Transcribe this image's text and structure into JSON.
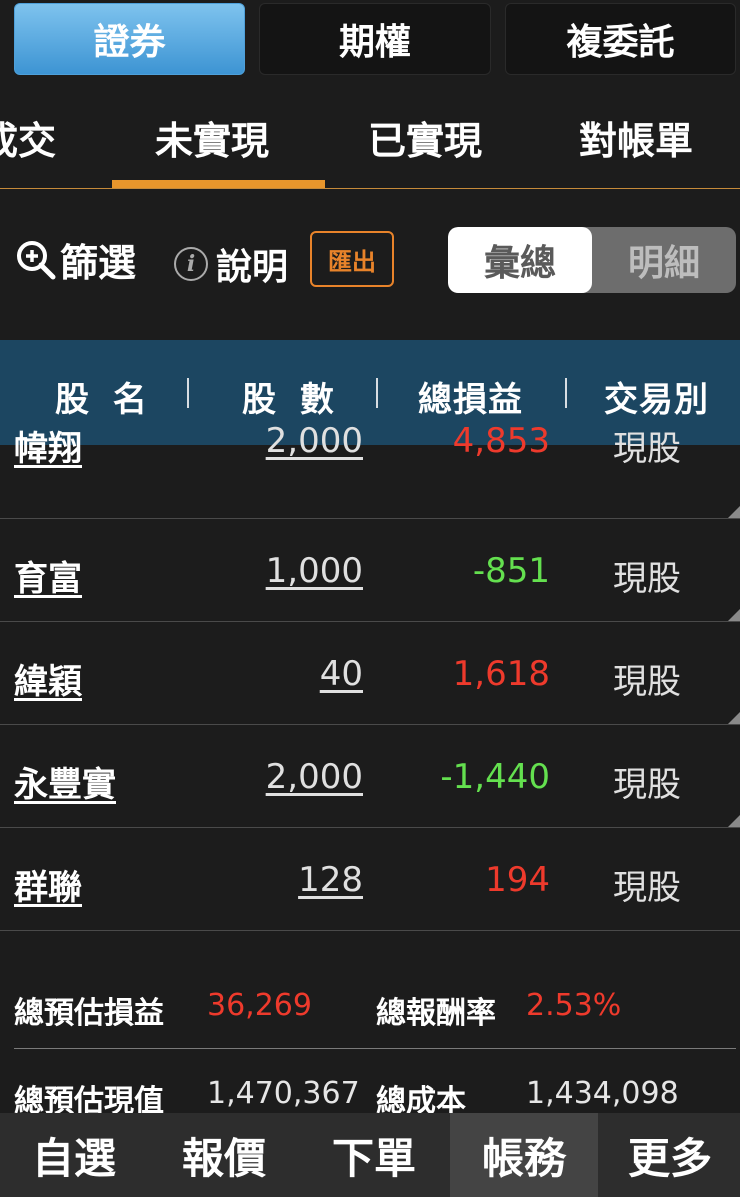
{
  "top_tabs": [
    {
      "label": "證券",
      "active": true
    },
    {
      "label": "期權",
      "active": false
    },
    {
      "label": "複委託",
      "active": false
    }
  ],
  "sub_tabs": [
    {
      "label": "成交"
    },
    {
      "label": "未實現",
      "active": true
    },
    {
      "label": "已實現"
    },
    {
      "label": "對帳單"
    }
  ],
  "toolbar": {
    "filter_label": "篩選",
    "explain_label": "說明",
    "info_glyph": "i",
    "export_label": "匯出",
    "toggle": {
      "on": "彙總",
      "off": "明細"
    }
  },
  "table": {
    "headers": [
      "股 名",
      "股 數",
      "總損益",
      "交易別"
    ],
    "rows": [
      {
        "name": "幃翔",
        "qty": "2,000",
        "pl": "4,853",
        "pl_sign": "pos",
        "type": "現股"
      },
      {
        "name": "育富",
        "qty": "1,000",
        "pl": "-851",
        "pl_sign": "neg",
        "type": "現股"
      },
      {
        "name": "緯穎",
        "qty": "40",
        "pl": "1,618",
        "pl_sign": "pos",
        "type": "現股"
      },
      {
        "name": "永豐實",
        "qty": "2,000",
        "pl": "-1,440",
        "pl_sign": "neg",
        "type": "現股"
      },
      {
        "name": "群聯",
        "qty": "128",
        "pl": "194",
        "pl_sign": "pos",
        "type": "現股"
      }
    ]
  },
  "summary": {
    "est_pl_label": "總預估損益",
    "est_pl_value": "36,269",
    "return_label": "總報酬率",
    "return_value": "2.53%",
    "est_value_label": "總預估現值",
    "est_value_value": "1,470,367",
    "cost_label": "總成本",
    "cost_value": "1,434,098"
  },
  "bottom_nav": [
    {
      "label": "自選"
    },
    {
      "label": "報價"
    },
    {
      "label": "下單"
    },
    {
      "label": "帳務",
      "active": true
    },
    {
      "label": "更多"
    }
  ],
  "colors": {
    "positive": "#ee3a2c",
    "negative": "#64e04f",
    "accent": "#e8962c",
    "header_bg": "#1c4661"
  }
}
